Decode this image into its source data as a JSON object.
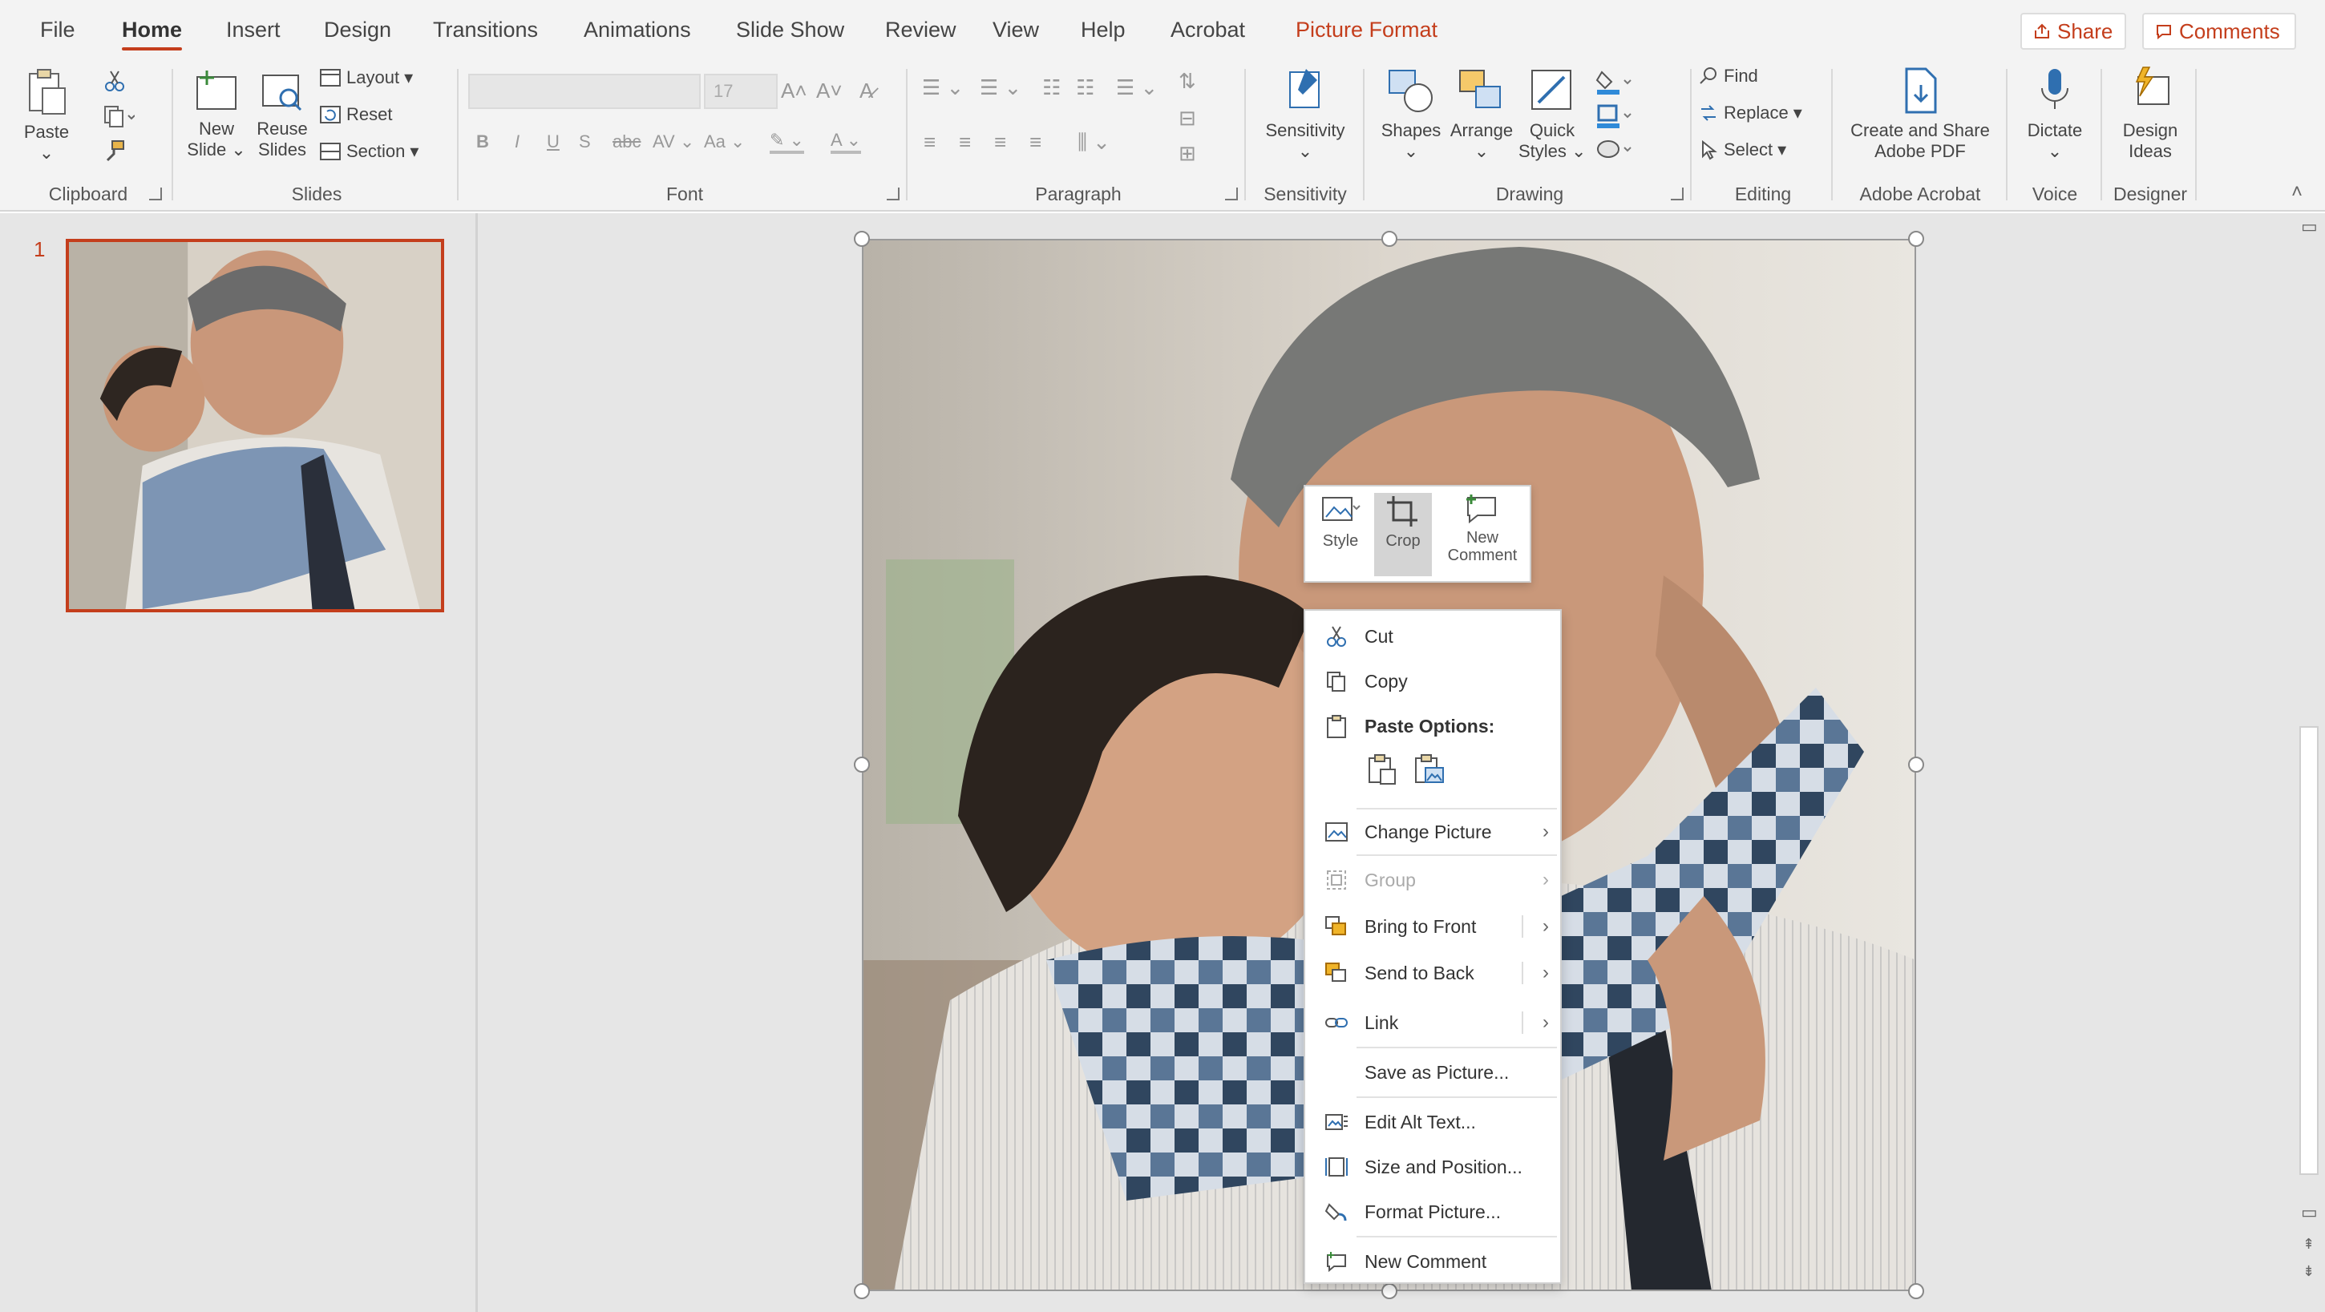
{
  "tabs": [
    "File",
    "Home",
    "Insert",
    "Design",
    "Transitions",
    "Animations",
    "Slide Show",
    "Review",
    "View",
    "Help",
    "Acrobat",
    "Picture Format"
  ],
  "active_tab": "Home",
  "top_buttons": {
    "share": "Share",
    "comments": "Comments"
  },
  "ribbon": {
    "clipboard": {
      "label": "Clipboard",
      "paste": "Paste"
    },
    "slides": {
      "label": "Slides",
      "new_slide": "New Slide",
      "new_slide_l1": "New",
      "new_slide_l2": "Slide",
      "reuse_l1": "Reuse",
      "reuse_l2": "Slides",
      "layout": "Layout",
      "reset": "Reset",
      "section": "Section"
    },
    "font": {
      "label": "Font",
      "size_placeholder": "17"
    },
    "paragraph": {
      "label": "Paragraph"
    },
    "sensitivity": {
      "label": "Sensitivity",
      "button": "Sensitivity"
    },
    "drawing": {
      "label": "Drawing",
      "shapes": "Shapes",
      "arrange": "Arrange",
      "quick_l1": "Quick",
      "quick_l2": "Styles"
    },
    "editing": {
      "label": "Editing",
      "find": "Find",
      "replace": "Replace",
      "select": "Select"
    },
    "acrobat": {
      "label": "Adobe Acrobat",
      "create_l1": "Create and Share",
      "create_l2": "Adobe PDF"
    },
    "voice": {
      "label": "Voice",
      "dictate": "Dictate"
    },
    "designer": {
      "label": "Designer",
      "ideas_l1": "Design",
      "ideas_l2": "Ideas"
    }
  },
  "slide_panel": {
    "slide_number": "1"
  },
  "mini_toolbar": {
    "style": "Style",
    "crop": "Crop",
    "new_comment_l1": "New",
    "new_comment_l2": "Comment"
  },
  "context_menu": {
    "cut": "Cut",
    "copy": "Copy",
    "paste_options": "Paste Options:",
    "change_picture": "Change Picture",
    "group": "Group",
    "bring_to_front": "Bring to Front",
    "send_to_back": "Send to Back",
    "link": "Link",
    "save_as_picture": "Save as Picture...",
    "edit_alt_text": "Edit Alt Text...",
    "size_and_position": "Size and Position...",
    "format_picture": "Format Picture...",
    "new_comment": "New Comment"
  },
  "colors": {
    "accent": "#c43e1c",
    "ribbon_bg": "#f3f3f3",
    "canvas_bg": "#e6e6e6"
  }
}
